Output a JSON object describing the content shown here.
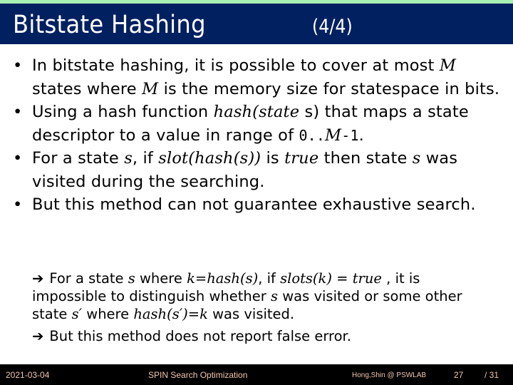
{
  "slide": {
    "title": "Bitstate Hashing",
    "subtitle": "(4/4)",
    "bullets": [
      {
        "parts": [
          {
            "t": "In bitstate hashing, it is possible to cover at most "
          },
          {
            "m": "M"
          },
          {
            "t": " states where "
          },
          {
            "m": "M"
          },
          {
            "t": " is the memory size for statespace in bits."
          }
        ]
      },
      {
        "parts": [
          {
            "t": "Using a hash function "
          },
          {
            "m": "hash(state"
          },
          {
            "t": " s) that maps a state descriptor to a value in range of "
          },
          {
            "tt": "0.."
          },
          {
            "m": "M"
          },
          {
            "tt": "-1"
          },
          {
            "t": "."
          }
        ]
      },
      {
        "parts": [
          {
            "t": "For a state "
          },
          {
            "m": "s"
          },
          {
            "t": ", if "
          },
          {
            "m": "slot(hash(s))"
          },
          {
            "t": " is "
          },
          {
            "m": "true"
          },
          {
            "t": " then state "
          },
          {
            "m": "s"
          },
          {
            "t": " was visited during the searching."
          }
        ]
      },
      {
        "parts": [
          {
            "t": "But this method can not guarantee exhaustive search."
          }
        ]
      }
    ],
    "bullet_glyph": "•",
    "arrow_glyph": "➔",
    "notes": [
      {
        "parts": [
          {
            "t": "For a state "
          },
          {
            "m": "s"
          },
          {
            "t": " where "
          },
          {
            "m": "k=hash(s)"
          },
          {
            "t": ", if "
          },
          {
            "m": "slots(k)"
          },
          {
            "t": " = "
          },
          {
            "m": "true"
          },
          {
            "t": " , it is impossible to distinguish whether "
          },
          {
            "m": "s"
          },
          {
            "t": " was visited or some other state "
          },
          {
            "m": "s′"
          },
          {
            "t": " where "
          },
          {
            "m": "hash(s′)=k"
          },
          {
            "t": " was visited."
          }
        ]
      },
      {
        "parts": [
          {
            "t": "But this method does not report false error."
          }
        ]
      }
    ]
  },
  "footer": {
    "date": "2021-03-04",
    "title": "SPIN Search Optimization",
    "author": "Hong,Shin @ PSWLAB",
    "page": "27",
    "total": "/ 31"
  },
  "colors": {
    "header_bg": "#012060",
    "top_strip": "#a8f0b4",
    "footer_bg": "#000000",
    "footer_text": "#f3c6b0"
  }
}
